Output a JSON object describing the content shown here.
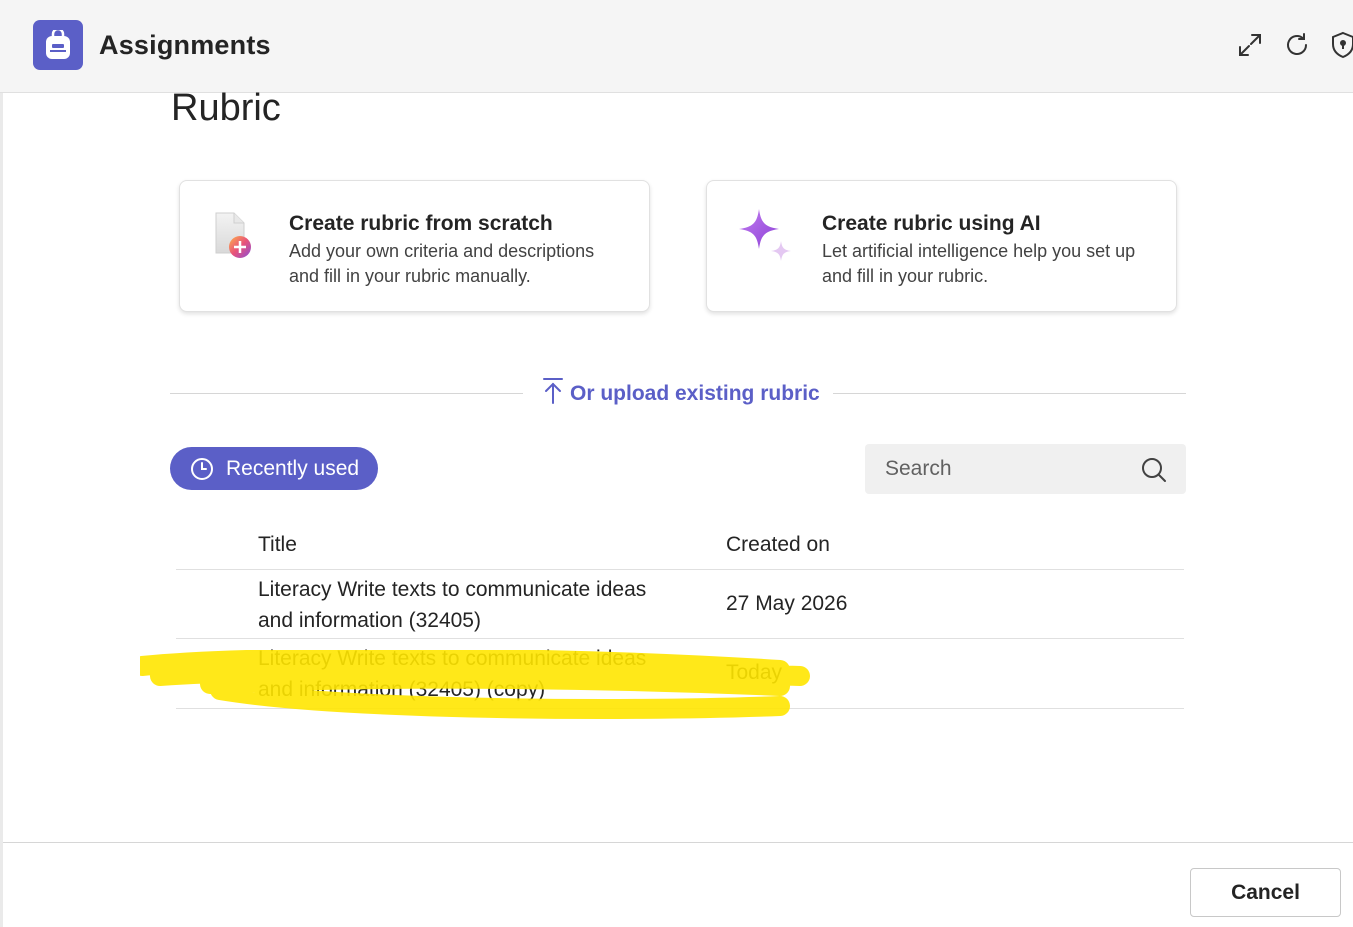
{
  "app": {
    "title": "Assignments",
    "icon": "backpack-icon",
    "accent_color": "#5b5fc7"
  },
  "toolbar": {
    "icons": [
      "expand-icon",
      "refresh-icon",
      "shield-icon"
    ]
  },
  "page": {
    "title": "Rubric"
  },
  "options": [
    {
      "title": "Create rubric from scratch",
      "description": "Add your own criteria and descriptions and fill in your rubric manually.",
      "icon": "new-document-icon"
    },
    {
      "title": "Create rubric using AI",
      "description": "Let artificial intelligence help you set up and fill in your rubric.",
      "icon": "sparkle-icon"
    }
  ],
  "upload": {
    "label": "Or upload existing rubric",
    "icon": "upload-icon"
  },
  "filter": {
    "label": "Recently used",
    "icon": "clock-icon"
  },
  "search": {
    "placeholder": "Search",
    "icon": "search-icon"
  },
  "table": {
    "columns": [
      "Title",
      "Created on"
    ],
    "rows": [
      {
        "title": "Literacy Write texts to communicate ideas and information (32405)",
        "created_on": "27 May 2026"
      },
      {
        "title": "Literacy Write texts to communicate ideas and information (32405) (copy)",
        "created_on": "Today"
      }
    ]
  },
  "highlight": {
    "color": "#ffe600"
  },
  "footer": {
    "cancel_label": "Cancel"
  }
}
